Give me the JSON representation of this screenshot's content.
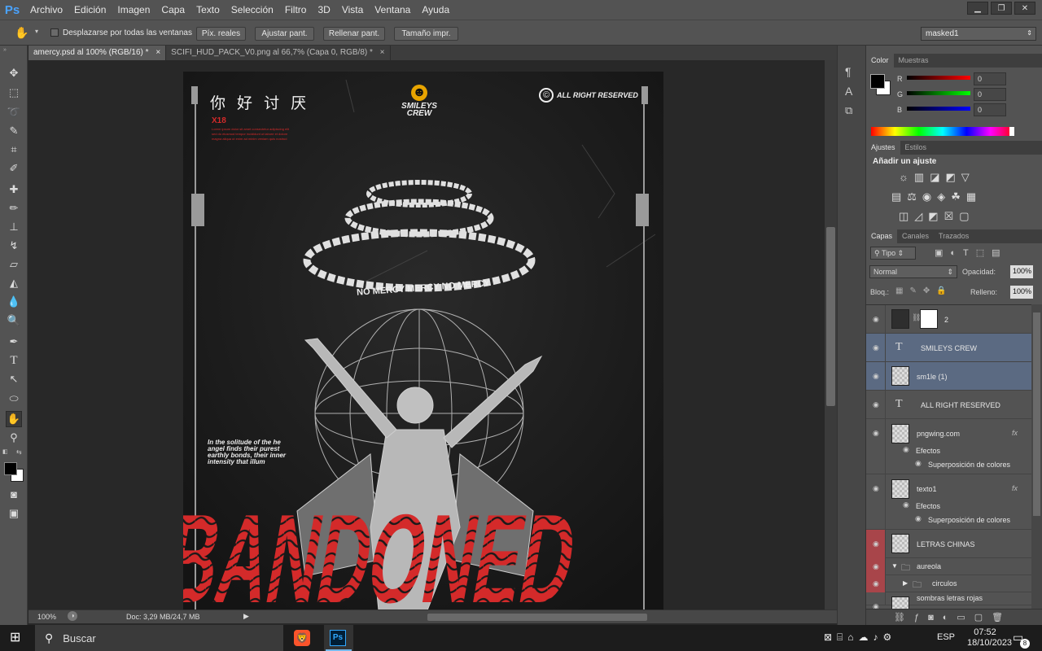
{
  "app": {
    "logo": "Ps"
  },
  "menu": [
    "Archivo",
    "Edición",
    "Imagen",
    "Capa",
    "Texto",
    "Selección",
    "Filtro",
    "3D",
    "Vista",
    "Ventana",
    "Ayuda"
  ],
  "window_controls": [
    "▁",
    "❐",
    "✕"
  ],
  "options": {
    "scroll_all_label": "Desplazarse por todas las ventanas",
    "btn_pix": "Píx. reales",
    "btn_fit": "Ajustar pant.",
    "btn_fill": "Rellenar pant.",
    "btn_print": "Tamaño impr.",
    "workspace": "masked1"
  },
  "tabs": [
    {
      "label": "amercy.psd al 100% (RGB/16) *",
      "close": "×"
    },
    {
      "label": "SCIFI_HUD_PACK_V0.png al 66,7% (Capa 0, RGB/8) *",
      "close": "×"
    }
  ],
  "poster": {
    "chinese": "你 好 讨 厌",
    "x18": "X18",
    "lorem": "Lorem ipsum dolor sit amet consectetur adipiscing elit sed do eiusmod tempor incididunt ut labore et dolore magna aliqua ut enim ad minim veniam quis nostrud",
    "smileys": "SMILEYS",
    "crew": "CREW",
    "copyright": "©",
    "rights": "ALL RIGHT RESERVED",
    "ring_text": "NO MERCY MERCY NO MERCY",
    "solitude": "In the solitude of the he\nangel finds their purest\nearthly bonds, their inner\nintensity that illum",
    "big_word": "ABANDONED",
    "smiley_face": "☻"
  },
  "status": {
    "zoom": "100%",
    "doc": "Doc: 3,29 MB/24,7 MB"
  },
  "color_panel": {
    "tabs": [
      "Color",
      "Muestras"
    ],
    "channels": [
      {
        "name": "R",
        "value": "0"
      },
      {
        "name": "G",
        "value": "0"
      },
      {
        "name": "B",
        "value": "0"
      }
    ]
  },
  "adjust_panel": {
    "tabs": [
      "Ajustes",
      "Estilos"
    ],
    "title": "Añadir un ajuste"
  },
  "layers_panel": {
    "tabs": [
      "Capas",
      "Canales",
      "Trazados"
    ],
    "filter": "Tipo",
    "blend": "Normal",
    "opacity_label": "Opacidad:",
    "opacity": "100%",
    "lock_label": "Bloq.:",
    "fill_label": "Relleno:",
    "fill": "100%",
    "layers": [
      {
        "name": "2",
        "kind": "mask"
      },
      {
        "name": "SMILEYS CREW",
        "kind": "text",
        "selected": true
      },
      {
        "name": "sm1le (1)",
        "kind": "image",
        "selected": true
      },
      {
        "name": "ALL RIGHT RESERVED",
        "kind": "text"
      },
      {
        "name": "pngwing.com",
        "kind": "image",
        "fx": "fx",
        "effects": "Efectos",
        "effect": "Superposición de colores"
      },
      {
        "name": "texto1",
        "kind": "image",
        "fx": "fx",
        "effects": "Efectos",
        "effect": "Superposición de colores"
      },
      {
        "name": "LETRAS CHINAS",
        "kind": "image",
        "red": true
      },
      {
        "name": "aureola",
        "kind": "group",
        "red": true
      },
      {
        "name": "circulos",
        "kind": "subgroup",
        "red": true
      },
      {
        "name": "sombras letras rojas",
        "kind": "image"
      }
    ]
  },
  "taskbar": {
    "search": "Buscar",
    "lang": "ESP",
    "time": "07:52",
    "date": "18/10/2023",
    "notif": "8"
  },
  "colors": {
    "accent_red": "#d42a2a",
    "panel": "#535353",
    "selected_layer": "#5b6a82",
    "red_vis": "#a8454a"
  }
}
